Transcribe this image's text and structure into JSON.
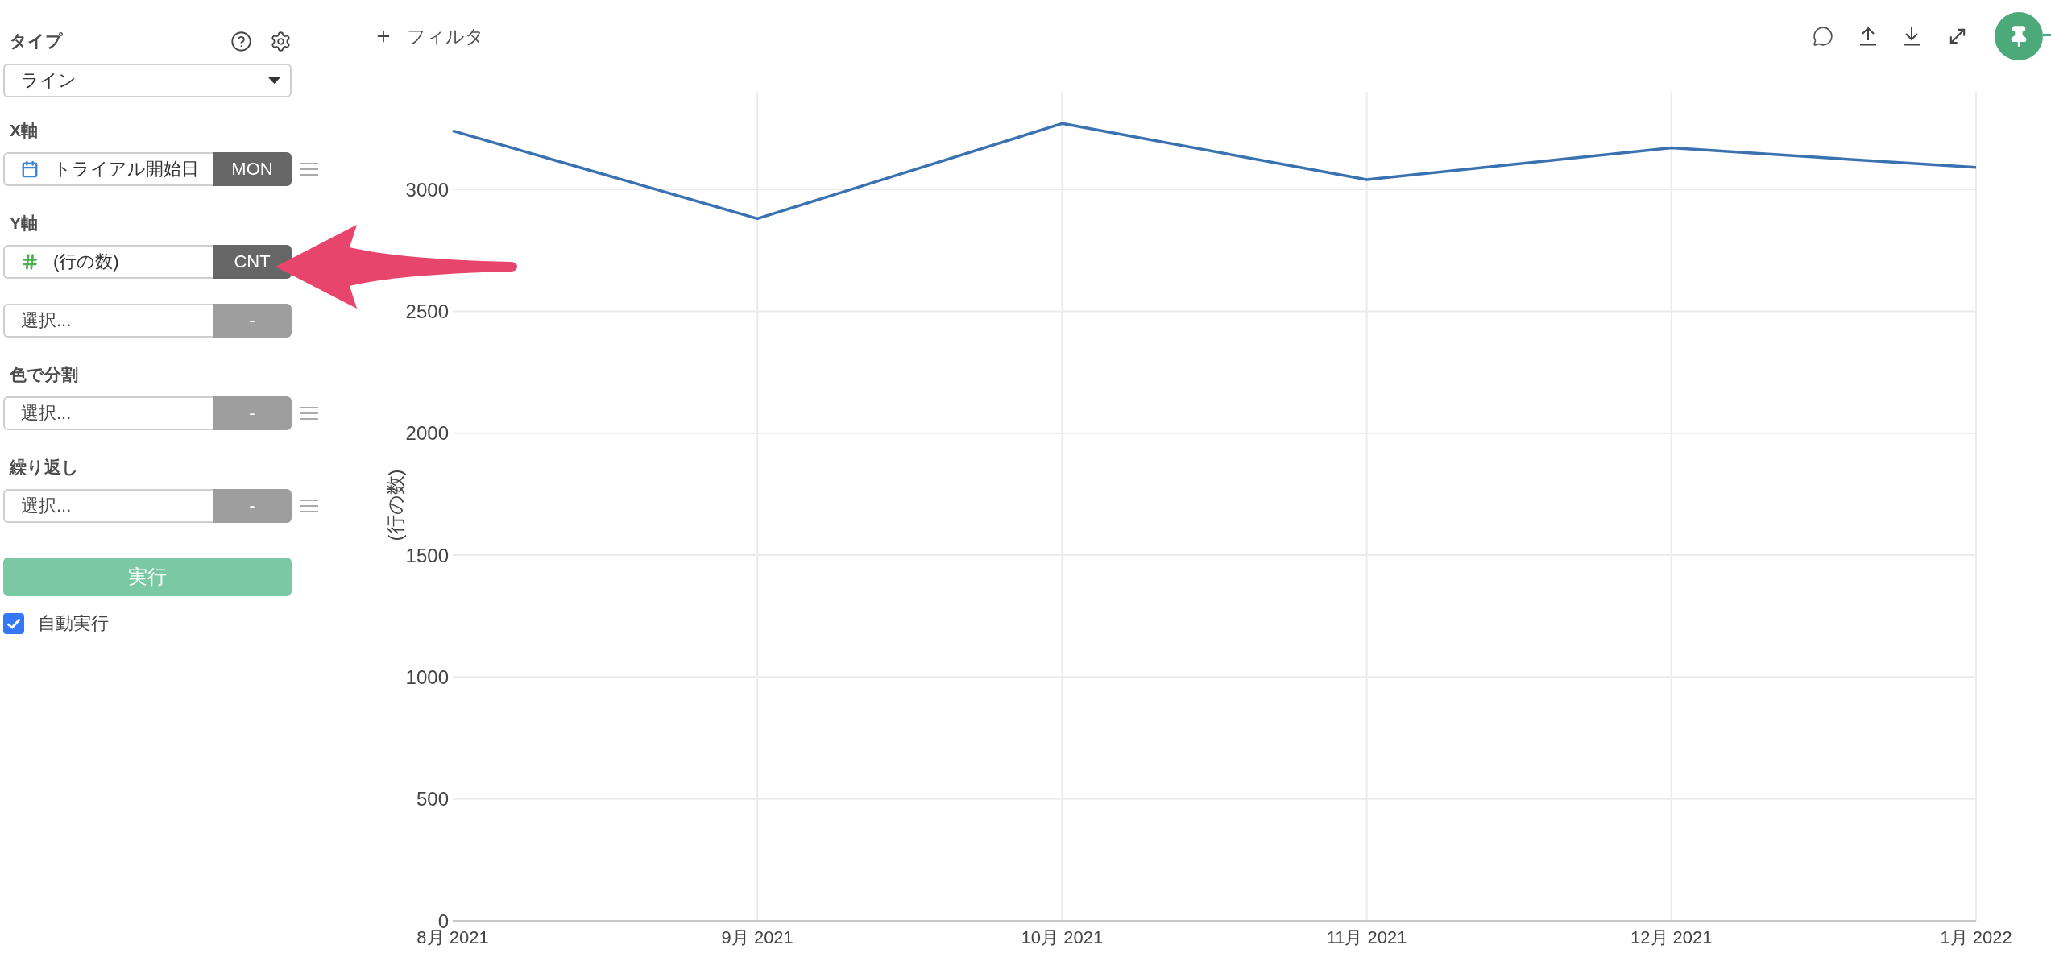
{
  "sidebar": {
    "type_section": {
      "label": "タイプ",
      "select": {
        "value": "ライン"
      }
    },
    "sections": [
      {
        "label": "X軸",
        "rows": [
          {
            "kind": "date",
            "value": "トライアル開始日",
            "aggregation": {
              "label": "MON",
              "disabled": false
            },
            "drag_handle": true
          }
        ]
      },
      {
        "label": "Y軸",
        "rows": [
          {
            "kind": "number",
            "value": "(行の数)",
            "aggregation": {
              "label": "CNT",
              "disabled": false
            },
            "drag_handle": false
          },
          {
            "kind": "empty",
            "placeholder": "選択...",
            "aggregation": {
              "label": "-",
              "disabled": true
            },
            "drag_handle": false
          }
        ]
      },
      {
        "label": "色で分割",
        "rows": [
          {
            "kind": "empty",
            "placeholder": "選択...",
            "aggregation": {
              "label": "-",
              "disabled": true
            },
            "drag_handle": true
          }
        ]
      },
      {
        "label": "繰り返し",
        "rows": [
          {
            "kind": "empty",
            "placeholder": "選択...",
            "aggregation": {
              "label": "-",
              "disabled": true
            },
            "drag_handle": true
          }
        ]
      }
    ],
    "run_button": {
      "label": "実行"
    },
    "auto_run": {
      "label": "自動実行",
      "checked": true
    }
  },
  "chart_panel": {
    "filter_button": {
      "label": "フィルタ"
    },
    "chart_data": {
      "type": "line",
      "ylabel": "(行の数)",
      "categories": [
        "8月 2021",
        "9月 2021",
        "10月 2021",
        "11月 2021",
        "12月 2021",
        "1月 2022"
      ],
      "series": [
        {
          "color": "#3a72b0",
          "values": [
            3240,
            2880,
            3270,
            3040,
            3170,
            3090
          ]
        }
      ],
      "ylim": [
        0,
        3400
      ],
      "yticks": [
        0,
        500,
        1000,
        1500,
        2000,
        2500,
        3000
      ],
      "grid": true
    }
  }
}
